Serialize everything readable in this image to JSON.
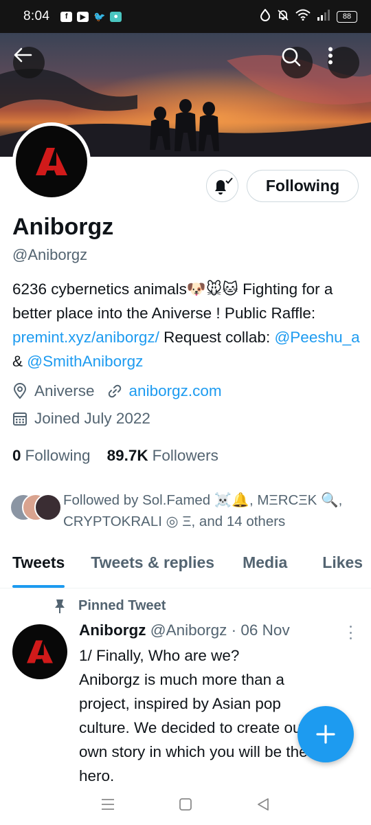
{
  "status_bar": {
    "time": "8:04",
    "battery": "88",
    "app_icons": [
      "facebook-icon",
      "youtube-icon",
      "twitter-icon",
      "app-icon"
    ]
  },
  "profile": {
    "name": "Aniborgz",
    "handle": "@Aniborgz",
    "following_button": "Following",
    "bio_text_1": "6236 cybernetics animals",
    "bio_emojis": "🐶🐭🐱",
    "bio_text_2": " Fighting for a better place into the Aniverse ! Public Raffle: ",
    "bio_link": "premint.xyz/aniborgz/",
    "bio_text_3": "  Request collab: ",
    "bio_mention_1": "@Peeshu_a",
    "bio_text_4": " & ",
    "bio_mention_2": "@SmithAniborgz",
    "location": "Aniverse",
    "website": "aniborgz.com",
    "joined": "Joined July 2022",
    "following_count": "0",
    "following_label": "Following",
    "followers_count": "89.7K",
    "followers_label": "Followers",
    "followed_by": "Followed by Sol.Famed ☠️🔔, MΞRCΞK 🔍, CRYPTOKRALI ◎ Ξ, and 14 others"
  },
  "tabs": [
    "Tweets",
    "Tweets & replies",
    "Media",
    "Likes"
  ],
  "pinned_tweet": {
    "label": "Pinned Tweet",
    "author": "Aniborgz",
    "handle": "@Aniborgz",
    "separator": " · ",
    "date": "06 Nov",
    "text": "1/ Finally, Who are we?\nAniborgz is much more than a project, inspired by Asian pop culture. We decided to create our own story in which you will be the hero."
  },
  "colors": {
    "accent": "#1d9bf0",
    "text": "#0f1419",
    "muted": "#536471",
    "logo_red": "#d11a1a"
  }
}
